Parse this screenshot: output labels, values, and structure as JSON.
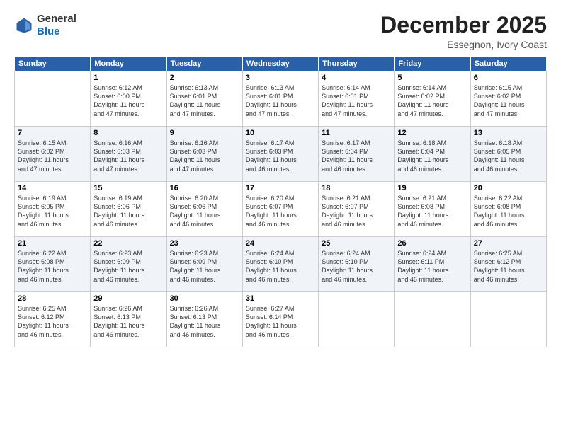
{
  "header": {
    "logo_line1": "General",
    "logo_line2": "Blue",
    "month": "December 2025",
    "location": "Essegnon, Ivory Coast"
  },
  "days_of_week": [
    "Sunday",
    "Monday",
    "Tuesday",
    "Wednesday",
    "Thursday",
    "Friday",
    "Saturday"
  ],
  "weeks": [
    [
      {
        "day": "",
        "info": ""
      },
      {
        "day": "1",
        "info": "Sunrise: 6:12 AM\nSunset: 6:00 PM\nDaylight: 11 hours\nand 47 minutes."
      },
      {
        "day": "2",
        "info": "Sunrise: 6:13 AM\nSunset: 6:01 PM\nDaylight: 11 hours\nand 47 minutes."
      },
      {
        "day": "3",
        "info": "Sunrise: 6:13 AM\nSunset: 6:01 PM\nDaylight: 11 hours\nand 47 minutes."
      },
      {
        "day": "4",
        "info": "Sunrise: 6:14 AM\nSunset: 6:01 PM\nDaylight: 11 hours\nand 47 minutes."
      },
      {
        "day": "5",
        "info": "Sunrise: 6:14 AM\nSunset: 6:02 PM\nDaylight: 11 hours\nand 47 minutes."
      },
      {
        "day": "6",
        "info": "Sunrise: 6:15 AM\nSunset: 6:02 PM\nDaylight: 11 hours\nand 47 minutes."
      }
    ],
    [
      {
        "day": "7",
        "info": "Sunrise: 6:15 AM\nSunset: 6:02 PM\nDaylight: 11 hours\nand 47 minutes."
      },
      {
        "day": "8",
        "info": "Sunrise: 6:16 AM\nSunset: 6:03 PM\nDaylight: 11 hours\nand 47 minutes."
      },
      {
        "day": "9",
        "info": "Sunrise: 6:16 AM\nSunset: 6:03 PM\nDaylight: 11 hours\nand 47 minutes."
      },
      {
        "day": "10",
        "info": "Sunrise: 6:17 AM\nSunset: 6:03 PM\nDaylight: 11 hours\nand 46 minutes."
      },
      {
        "day": "11",
        "info": "Sunrise: 6:17 AM\nSunset: 6:04 PM\nDaylight: 11 hours\nand 46 minutes."
      },
      {
        "day": "12",
        "info": "Sunrise: 6:18 AM\nSunset: 6:04 PM\nDaylight: 11 hours\nand 46 minutes."
      },
      {
        "day": "13",
        "info": "Sunrise: 6:18 AM\nSunset: 6:05 PM\nDaylight: 11 hours\nand 46 minutes."
      }
    ],
    [
      {
        "day": "14",
        "info": "Sunrise: 6:19 AM\nSunset: 6:05 PM\nDaylight: 11 hours\nand 46 minutes."
      },
      {
        "day": "15",
        "info": "Sunrise: 6:19 AM\nSunset: 6:06 PM\nDaylight: 11 hours\nand 46 minutes."
      },
      {
        "day": "16",
        "info": "Sunrise: 6:20 AM\nSunset: 6:06 PM\nDaylight: 11 hours\nand 46 minutes."
      },
      {
        "day": "17",
        "info": "Sunrise: 6:20 AM\nSunset: 6:07 PM\nDaylight: 11 hours\nand 46 minutes."
      },
      {
        "day": "18",
        "info": "Sunrise: 6:21 AM\nSunset: 6:07 PM\nDaylight: 11 hours\nand 46 minutes."
      },
      {
        "day": "19",
        "info": "Sunrise: 6:21 AM\nSunset: 6:08 PM\nDaylight: 11 hours\nand 46 minutes."
      },
      {
        "day": "20",
        "info": "Sunrise: 6:22 AM\nSunset: 6:08 PM\nDaylight: 11 hours\nand 46 minutes."
      }
    ],
    [
      {
        "day": "21",
        "info": "Sunrise: 6:22 AM\nSunset: 6:08 PM\nDaylight: 11 hours\nand 46 minutes."
      },
      {
        "day": "22",
        "info": "Sunrise: 6:23 AM\nSunset: 6:09 PM\nDaylight: 11 hours\nand 46 minutes."
      },
      {
        "day": "23",
        "info": "Sunrise: 6:23 AM\nSunset: 6:09 PM\nDaylight: 11 hours\nand 46 minutes."
      },
      {
        "day": "24",
        "info": "Sunrise: 6:24 AM\nSunset: 6:10 PM\nDaylight: 11 hours\nand 46 minutes."
      },
      {
        "day": "25",
        "info": "Sunrise: 6:24 AM\nSunset: 6:10 PM\nDaylight: 11 hours\nand 46 minutes."
      },
      {
        "day": "26",
        "info": "Sunrise: 6:24 AM\nSunset: 6:11 PM\nDaylight: 11 hours\nand 46 minutes."
      },
      {
        "day": "27",
        "info": "Sunrise: 6:25 AM\nSunset: 6:12 PM\nDaylight: 11 hours\nand 46 minutes."
      }
    ],
    [
      {
        "day": "28",
        "info": "Sunrise: 6:25 AM\nSunset: 6:12 PM\nDaylight: 11 hours\nand 46 minutes."
      },
      {
        "day": "29",
        "info": "Sunrise: 6:26 AM\nSunset: 6:13 PM\nDaylight: 11 hours\nand 46 minutes."
      },
      {
        "day": "30",
        "info": "Sunrise: 6:26 AM\nSunset: 6:13 PM\nDaylight: 11 hours\nand 46 minutes."
      },
      {
        "day": "31",
        "info": "Sunrise: 6:27 AM\nSunset: 6:14 PM\nDaylight: 11 hours\nand 46 minutes."
      },
      {
        "day": "",
        "info": ""
      },
      {
        "day": "",
        "info": ""
      },
      {
        "day": "",
        "info": ""
      }
    ]
  ]
}
